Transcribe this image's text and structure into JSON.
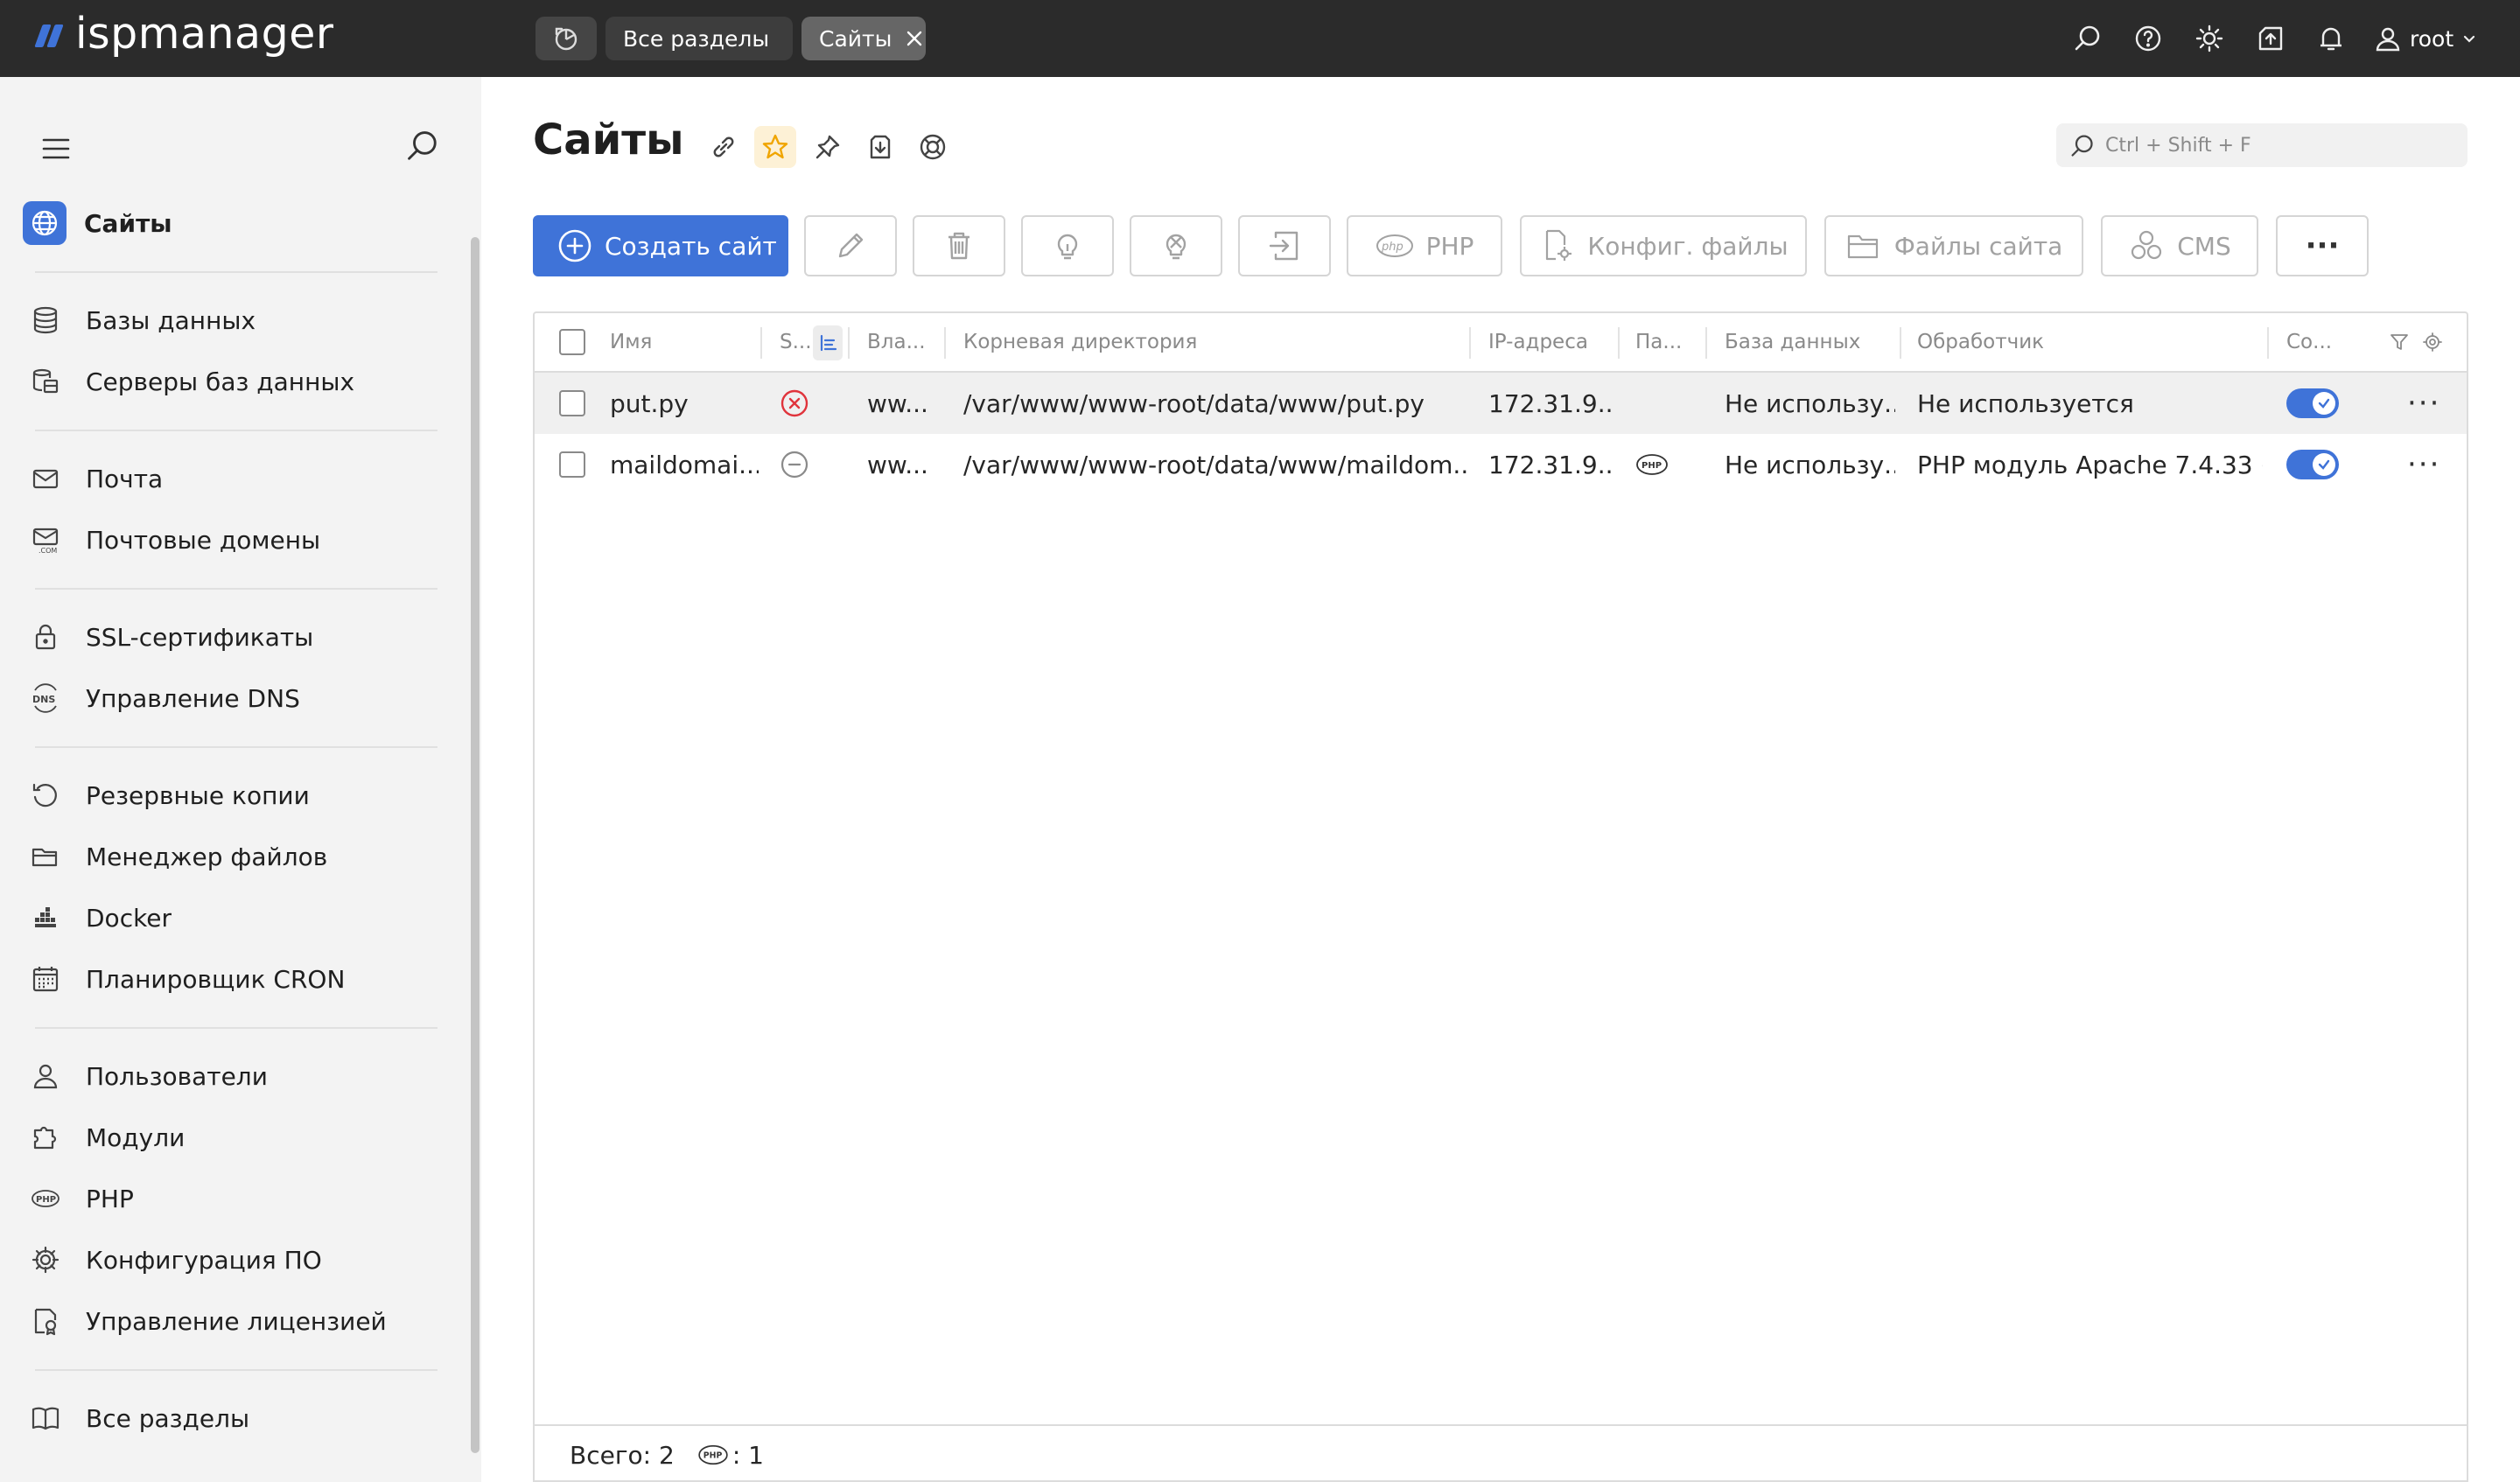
{
  "app": {
    "logo_text": "ispmanager",
    "tabs": [
      {
        "label": "Все разделы"
      },
      {
        "label": "Сайты"
      }
    ],
    "user": "root",
    "top_icons": [
      "search-icon",
      "help-icon",
      "theme-sun-icon",
      "update-icon",
      "bell-icon",
      "user-icon"
    ]
  },
  "sidebar": {
    "items": [
      {
        "label": "Сайты",
        "icon": "globe-icon",
        "active": true
      },
      {
        "label": "Базы данных",
        "icon": "database-icon"
      },
      {
        "label": "Серверы баз данных",
        "icon": "db-servers-icon"
      },
      {
        "label": "Почта",
        "icon": "mail-icon"
      },
      {
        "label": "Почтовые домены",
        "icon": "mail-domain-icon"
      },
      {
        "label": "SSL-сертификаты",
        "icon": "lock-icon"
      },
      {
        "label": "Управление DNS",
        "icon": "dns-icon"
      },
      {
        "label": "Резервные копии",
        "icon": "backup-icon"
      },
      {
        "label": "Менеджер файлов",
        "icon": "folder-icon"
      },
      {
        "label": "Docker",
        "icon": "docker-icon"
      },
      {
        "label": "Планировщик CRON",
        "icon": "calendar-icon"
      },
      {
        "label": "Пользователи",
        "icon": "user-icon"
      },
      {
        "label": "Модули",
        "icon": "puzzle-icon"
      },
      {
        "label": "PHP",
        "icon": "php-icon"
      },
      {
        "label": "Конфигурация ПО",
        "icon": "gear-icon"
      },
      {
        "label": "Управление лицензией",
        "icon": "license-icon"
      },
      {
        "label": "Все разделы",
        "icon": "book-icon"
      }
    ]
  },
  "main": {
    "title": "Сайты",
    "search_placeholder": "Ctrl + Shift + F",
    "toolbar": {
      "create_label": "Создать сайт",
      "php_label": "PHP",
      "config_label": "Конфиг. файлы",
      "files_label": "Файлы сайта",
      "cms_label": "CMS",
      "more_label": "···"
    },
    "columns": [
      "Имя",
      "S...",
      "Вла...",
      "Корневая директория",
      "IP-адреса",
      "Па...",
      "База данных",
      "Обработчик",
      "Со..."
    ],
    "rows": [
      {
        "name": "put.py",
        "status": "error",
        "owner": "ww...",
        "root": "/var/www/www-root/data/www/put.py",
        "ip": "172.31.9...",
        "params": "",
        "database": "Не использу...",
        "handler": "Не используется",
        "enabled": true
      },
      {
        "name": "maildomai...",
        "status": "disabled",
        "owner": "ww...",
        "root": "/var/www/www-root/data/www/maildom...",
        "ip": "172.31.9...",
        "params": "PHP",
        "database": "Не использу...",
        "handler": "PHP модуль Apache 7.4.33 (...",
        "enabled": true
      }
    ],
    "footer": {
      "total_label": "Всего: 2",
      "php_count": ": 1"
    }
  },
  "colors": {
    "accent": "#3f73d8",
    "topbar": "#2b2b2b",
    "sidebar": "#f3f3f3",
    "error": "#e0343c",
    "favorite": "#f0a500"
  }
}
